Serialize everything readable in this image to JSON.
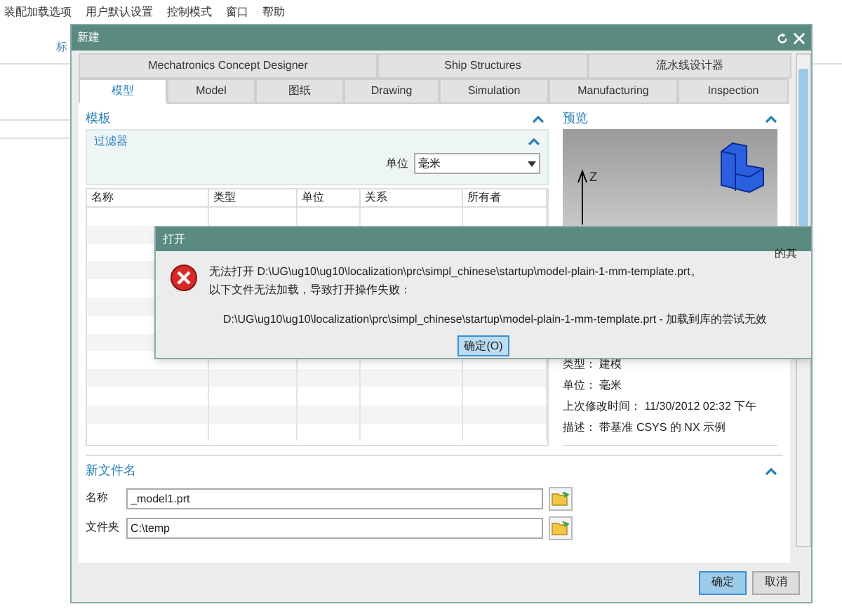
{
  "ribbon": {
    "items": [
      "装配加载选项",
      "用户默认设置",
      "控制模式",
      "窗口",
      "帮助"
    ],
    "group_label": "标"
  },
  "dialog": {
    "title": "新建",
    "tab_rows": [
      [
        {
          "label": "Mechatronics Concept Designer",
          "selected": false
        },
        {
          "label": "Ship Structures",
          "selected": false
        },
        {
          "label": "流水线设计器",
          "selected": false
        }
      ],
      [
        {
          "label": "模型",
          "selected": true
        },
        {
          "label": "Model",
          "selected": false
        },
        {
          "label": "图纸",
          "selected": false
        },
        {
          "label": "Drawing",
          "selected": false
        },
        {
          "label": "Simulation",
          "selected": false
        },
        {
          "label": "Manufacturing",
          "selected": false
        },
        {
          "label": "Inspection",
          "selected": false
        }
      ]
    ],
    "templates": {
      "title": "模板",
      "expanded": true,
      "filter": {
        "title": "过滤器",
        "expanded": true,
        "unit_label": "单位",
        "unit_value": "毫米"
      },
      "table": {
        "columns": [
          "名称",
          "类型",
          "单位",
          "关系",
          "所有者"
        ]
      }
    },
    "preview": {
      "title": "预览",
      "expanded": true,
      "axis_label": "Z",
      "clipped_text": "的其",
      "details": [
        "类型： 建模",
        "单位： 毫米",
        "上次修改时间： 11/30/2012 02:32 下午",
        "描述： 带基准 CSYS 的 NX 示例"
      ]
    },
    "new_file": {
      "title": "新文件名",
      "expanded": true,
      "name_label": "名称",
      "name_value": "_model1.prt",
      "folder_label": "文件夹",
      "folder_value": "C:\\temp"
    },
    "buttons": [
      {
        "label": "确定",
        "kind": "primary"
      },
      {
        "label": "取消",
        "kind": "normal"
      }
    ]
  },
  "error_dialog": {
    "title": "打开",
    "lines": [
      "无法打开 D:\\UG\\ug10\\ug10\\localization\\prc\\simpl_chinese\\startup\\model-plain-1-mm-template.prt。",
      "以下文件无法加载，导致打开操作失败："
    ],
    "detail": "D:\\UG\\ug10\\ug10\\localization\\prc\\simpl_chinese\\startup\\model-plain-1-mm-template.prt - 加载到库的尝试无效",
    "button": "确定(O)"
  }
}
